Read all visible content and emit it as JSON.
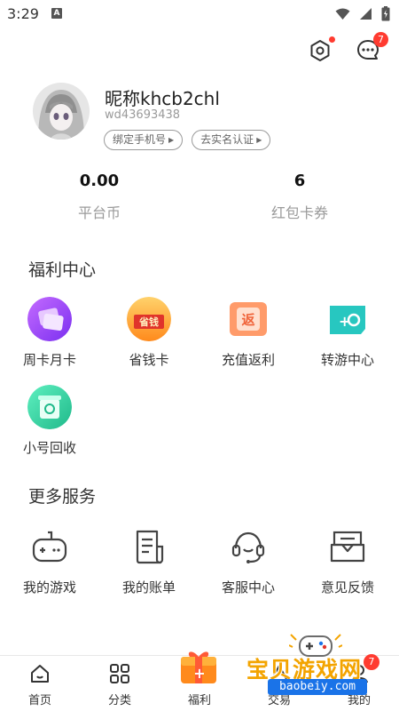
{
  "status_bar": {
    "time": "3:29",
    "a_icon": "A"
  },
  "header": {
    "message_badge": "7"
  },
  "profile": {
    "nickname": "昵称khcb2chl",
    "user_id": "wd43693438",
    "bind_phone": "绑定手机号",
    "real_name": "去实名认证"
  },
  "stats": [
    {
      "value": "0.00",
      "label": "平台币"
    },
    {
      "value": "6",
      "label": "红包卡券"
    }
  ],
  "welfare": {
    "title": "福利中心",
    "items": [
      {
        "label": "周卡月卡",
        "icon": "weekly-monthly-card-icon"
      },
      {
        "label": "省钱卡",
        "icon": "money-saving-card-icon",
        "icon_text": "省钱"
      },
      {
        "label": "充值返利",
        "icon": "recharge-rebate-icon",
        "icon_text": "返"
      },
      {
        "label": "转游中心",
        "icon": "game-transfer-icon"
      },
      {
        "label": "小号回收",
        "icon": "account-recycle-icon"
      }
    ]
  },
  "services": {
    "title": "更多服务",
    "items": [
      {
        "label": "我的游戏",
        "icon": "gamepad-icon"
      },
      {
        "label": "我的账单",
        "icon": "bill-icon"
      },
      {
        "label": "客服中心",
        "icon": "headset-icon"
      },
      {
        "label": "意见反馈",
        "icon": "feedback-inbox-icon"
      }
    ]
  },
  "tabbar": {
    "tabs": [
      {
        "label": "首页",
        "icon": "home-icon"
      },
      {
        "label": "分类",
        "icon": "category-icon"
      },
      {
        "label": "福利",
        "icon": "gift-icon"
      },
      {
        "label": "交易",
        "icon": "trade-icon"
      },
      {
        "label": "我的",
        "icon": "profile-icon"
      }
    ],
    "badge": "7"
  },
  "watermark": {
    "text": "宝贝游戏网",
    "url": "baobeiy.com"
  },
  "colors": {
    "badge_red": "#ff3b30",
    "text_primary": "#222222",
    "text_secondary": "#9a9a9a",
    "watermark_orange": "#f3a400",
    "watermark_blue": "#1a73e8"
  }
}
